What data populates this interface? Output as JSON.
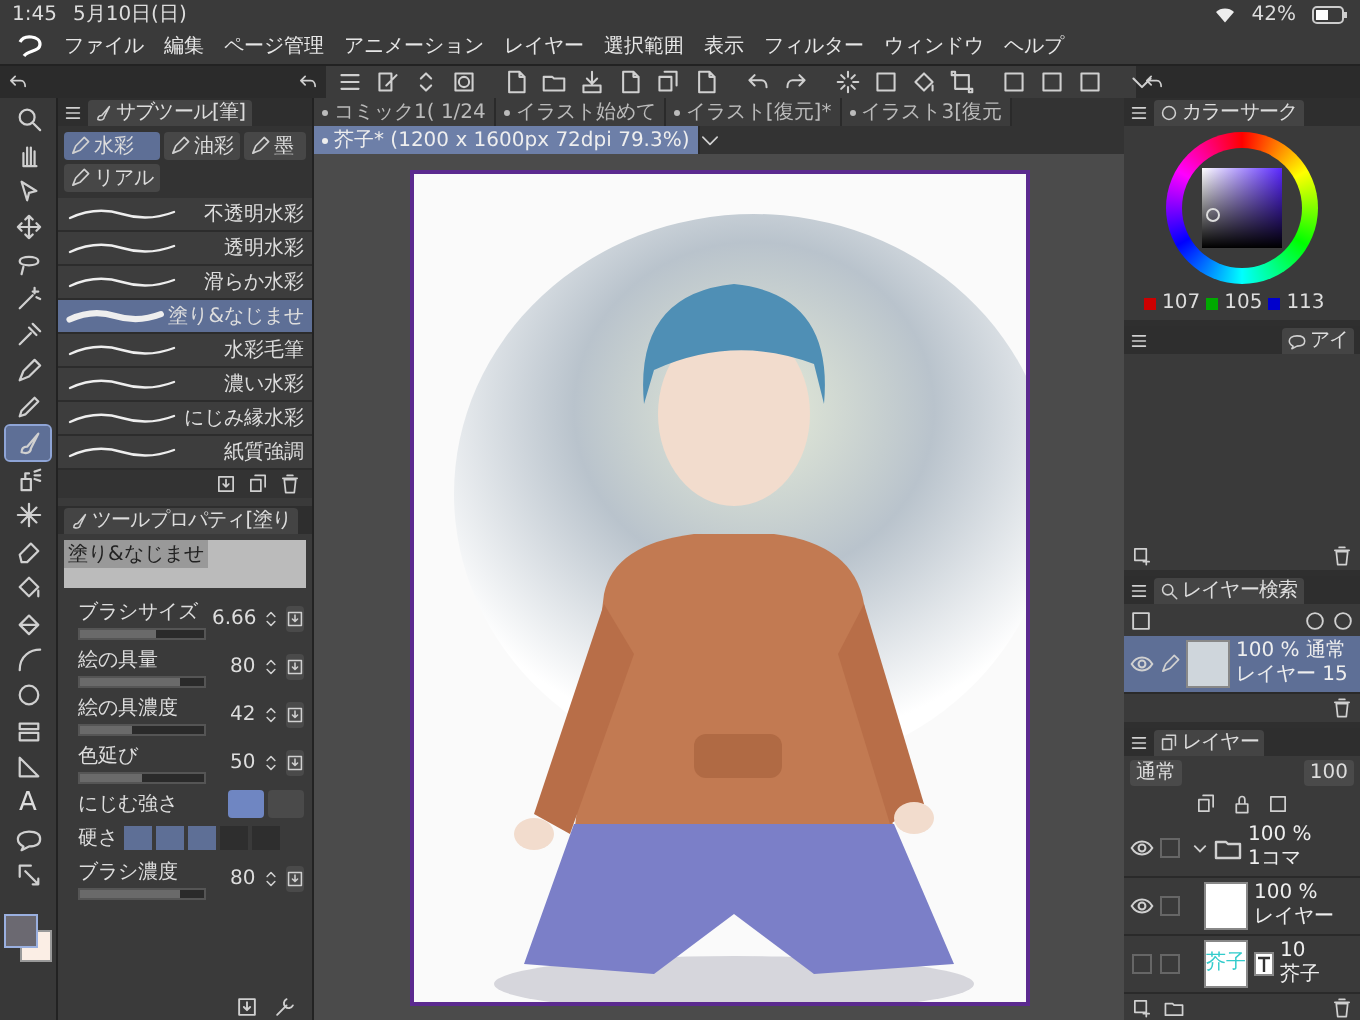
{
  "status_bar": {
    "time": "1:45",
    "date": "5月10日(日)",
    "battery": "42%"
  },
  "menu": [
    "ファイル",
    "編集",
    "ページ管理",
    "アニメーション",
    "レイヤー",
    "選択範囲",
    "表示",
    "フィルター",
    "ウィンドウ",
    "ヘルプ"
  ],
  "tools": [
    {
      "kind": "magnifier",
      "selected": false
    },
    {
      "kind": "hand",
      "selected": false
    },
    {
      "kind": "cursor",
      "selected": false
    },
    {
      "kind": "move",
      "selected": false
    },
    {
      "kind": "lasso",
      "selected": false
    },
    {
      "kind": "wand",
      "selected": false
    },
    {
      "kind": "eyedropper",
      "selected": false
    },
    {
      "kind": "pen",
      "selected": false
    },
    {
      "kind": "pencil",
      "selected": false
    },
    {
      "kind": "brush",
      "selected": true
    },
    {
      "kind": "airbrush",
      "selected": false
    },
    {
      "kind": "sparkle",
      "selected": false
    },
    {
      "kind": "eraser",
      "selected": false
    },
    {
      "kind": "bucket",
      "selected": false
    },
    {
      "kind": "fill",
      "selected": false
    },
    {
      "kind": "curve",
      "selected": false
    },
    {
      "kind": "circle",
      "selected": false
    },
    {
      "kind": "frame",
      "selected": false
    },
    {
      "kind": "ruler",
      "selected": false
    },
    {
      "kind": "text",
      "glyph": "A",
      "selected": false
    },
    {
      "kind": "balloon",
      "selected": false
    },
    {
      "kind": "pointer",
      "selected": false
    }
  ],
  "left_panel": {
    "subtool_title": "サブツール[筆]",
    "categories": [
      {
        "label": "水彩",
        "selected": true
      },
      {
        "label": "油彩",
        "selected": false
      },
      {
        "label": "墨",
        "selected": false
      },
      {
        "label": "リアル",
        "selected": false
      }
    ],
    "brushes": [
      {
        "name": "不透明水彩",
        "selected": false
      },
      {
        "name": "透明水彩",
        "selected": false
      },
      {
        "name": "滑らか水彩",
        "selected": false
      },
      {
        "name": "塗り&なじませ",
        "selected": true
      },
      {
        "name": "水彩毛筆",
        "selected": false
      },
      {
        "name": "濃い水彩",
        "selected": false
      },
      {
        "name": "にじみ縁水彩",
        "selected": false
      },
      {
        "name": "紙質強調",
        "selected": false
      }
    ],
    "property_title": "ツールプロパティ[塗り",
    "preview_name": "塗り&なじませ",
    "properties": [
      {
        "kind": "slider",
        "label": "ブラシサイズ",
        "value": "6.66",
        "level": 0.62
      },
      {
        "kind": "slider",
        "label": "絵の具量",
        "value": "80",
        "level": 0.8
      },
      {
        "kind": "slider",
        "label": "絵の具濃度",
        "value": "42",
        "level": 0.42
      },
      {
        "kind": "slider",
        "label": "色延び",
        "value": "50",
        "level": 0.5
      },
      {
        "kind": "toggle",
        "label": "にじむ強さ"
      },
      {
        "kind": "segments",
        "label": "硬さ",
        "level": 0.6
      },
      {
        "kind": "slider",
        "label": "ブラシ濃度",
        "value": "80",
        "level": 0.8
      }
    ]
  },
  "document_tabs": [
    {
      "label": "コミック1( 1/24",
      "selected": false
    },
    {
      "label": "イラスト始めて",
      "selected": false
    },
    {
      "label": "イラスト[復元]*",
      "selected": false
    },
    {
      "label": "イラスト3[復元",
      "selected": false
    },
    {
      "label": "芥子* (1200 x 1600px 72dpi 79.3%)",
      "selected": true
    }
  ],
  "color_panel": {
    "title": "カラーサーク",
    "red": "107",
    "green": "105",
    "blue": "113"
  },
  "item_panel": {
    "title": "アイ"
  },
  "layer_search_panel": {
    "title": "レイヤー検索",
    "layers": [
      {
        "info": "100 % 通常",
        "name": "レイヤー 15",
        "selected": true,
        "visible": true
      }
    ]
  },
  "layer_panel": {
    "title": "レイヤー",
    "blend_mode": "通常",
    "opacity": "100",
    "layers": [
      {
        "kind": "folder",
        "info": "100 %",
        "name": "1コマ",
        "visible": true,
        "checked": false,
        "expanded": true,
        "children": [
          {
            "kind": "raster",
            "info": "100 %",
            "name": "レイヤー",
            "visible": true,
            "checked": false
          },
          {
            "kind": "text",
            "info": "10",
            "name": "芥子",
            "thumbnail_text": "芥子",
            "visible": false,
            "checked": false
          }
        ]
      }
    ]
  }
}
